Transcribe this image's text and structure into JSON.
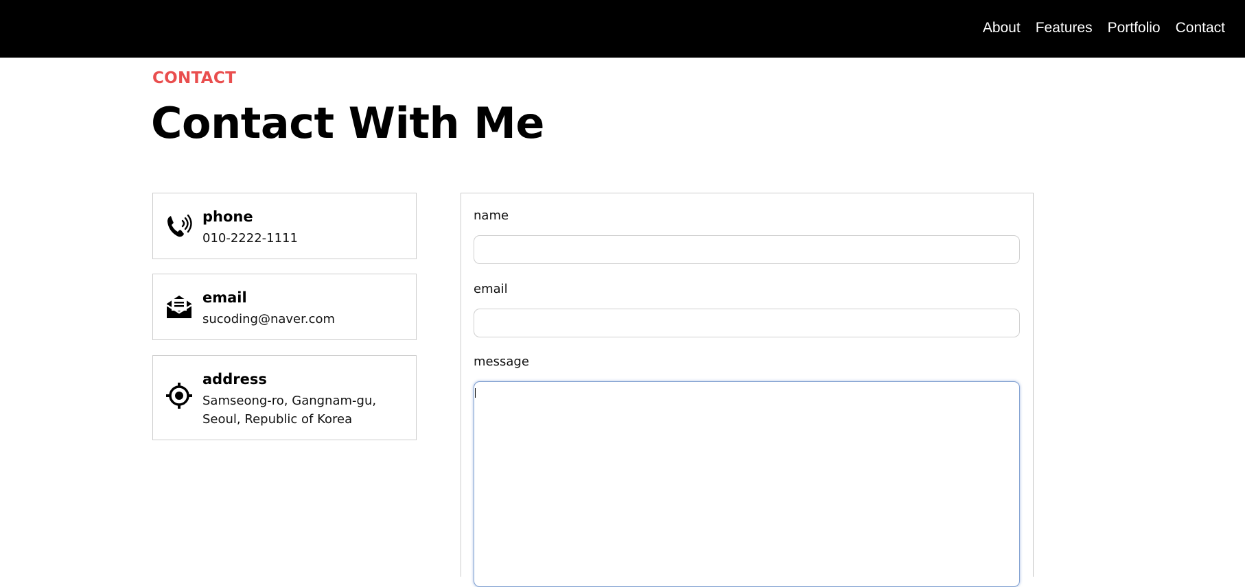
{
  "nav": {
    "items": [
      {
        "label": "About"
      },
      {
        "label": "Features"
      },
      {
        "label": "Portfolio"
      },
      {
        "label": "Contact"
      }
    ]
  },
  "section": {
    "eyebrow": "CONTACT",
    "title": "Contact With Me"
  },
  "contact_info": {
    "phone": {
      "title": "phone",
      "value": "010-2222-1111",
      "icon": "phone-icon"
    },
    "email": {
      "title": "email",
      "value": "sucoding@naver.com",
      "icon": "open-envelope-icon"
    },
    "address": {
      "title": "address",
      "value": "Samseong-ro, Gangnam-gu, Seoul, Republic of Korea",
      "icon": "location-target-icon"
    }
  },
  "form": {
    "name_label": "name",
    "name_value": "",
    "email_label": "email",
    "email_value": "",
    "message_label": "message",
    "message_value": ""
  },
  "colors": {
    "navbar_bg": "#000000",
    "accent": "#e94e4e",
    "border": "#cccccc",
    "focus_border": "#7f9fd0"
  }
}
